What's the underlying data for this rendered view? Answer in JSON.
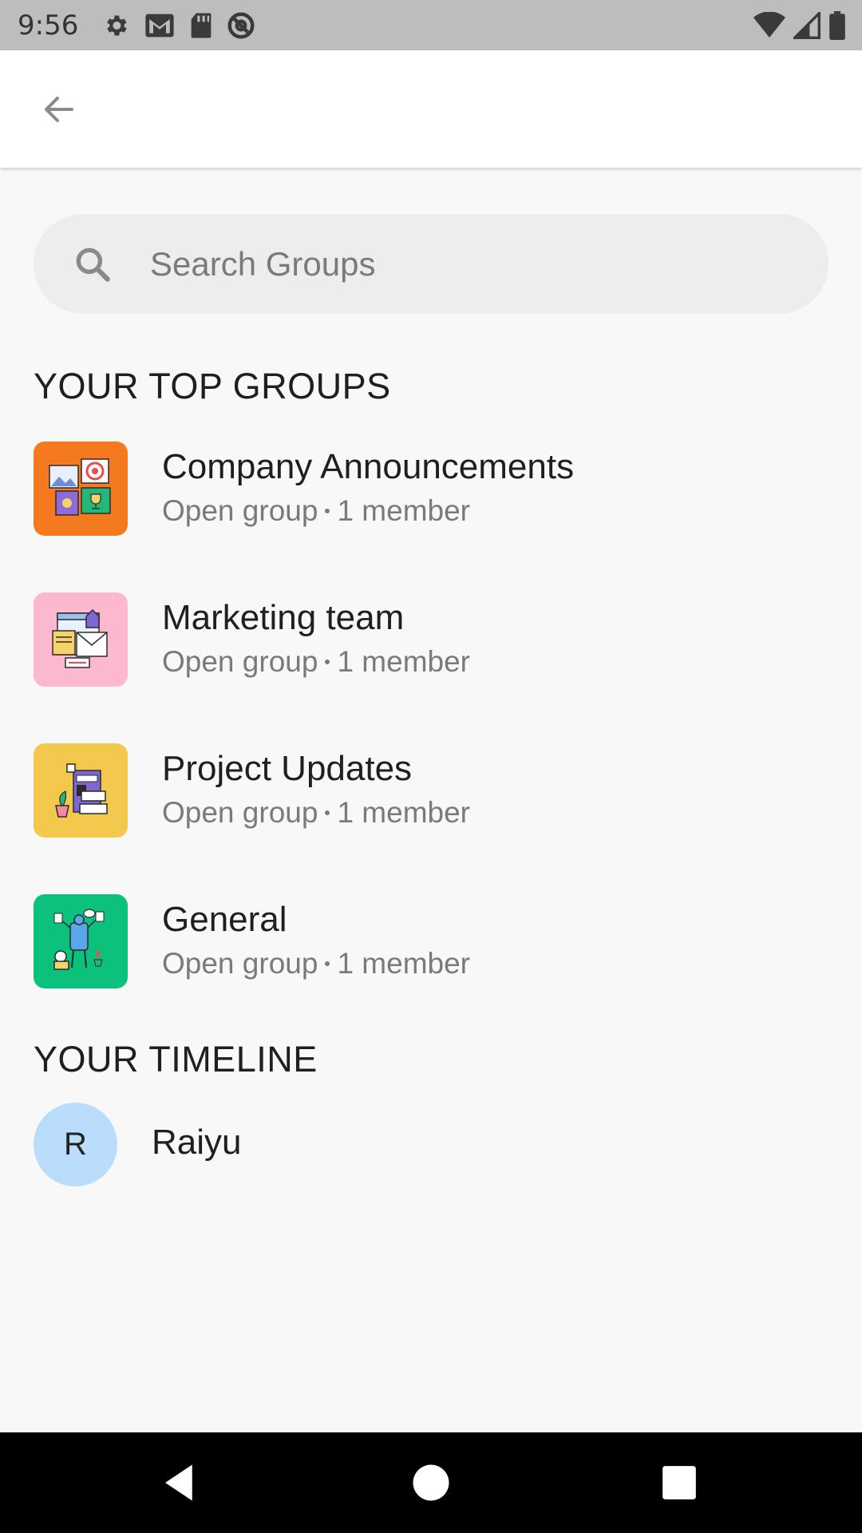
{
  "status_bar": {
    "time": "9:56",
    "left_icons": [
      "gear-icon",
      "gmail-icon",
      "sd-card-icon",
      "at-sign-icon"
    ],
    "right_icons": [
      "wifi-icon",
      "signal-icon",
      "battery-icon"
    ]
  },
  "app_bar": {
    "back_icon": "arrow-back-icon"
  },
  "search": {
    "placeholder": "Search Groups",
    "value": ""
  },
  "top_groups": {
    "header": "YOUR TOP GROUPS",
    "items": [
      {
        "name": "Company Announcements",
        "type": "Open group",
        "members": "1 member",
        "color": "#f5791f",
        "icon": "announcements-illustration"
      },
      {
        "name": "Marketing team",
        "type": "Open group",
        "members": "1 member",
        "color": "#fcb8cf",
        "icon": "marketing-illustration"
      },
      {
        "name": "Project Updates",
        "type": "Open group",
        "members": "1 member",
        "color": "#f2c94c",
        "icon": "project-illustration"
      },
      {
        "name": "General",
        "type": "Open group",
        "members": "1 member",
        "color": "#0bc27c",
        "icon": "general-illustration"
      }
    ]
  },
  "timeline": {
    "header": "YOUR TIMELINE",
    "user": {
      "initial": "R",
      "name": "Raiyu",
      "avatar_color": "#b9ddfb"
    }
  },
  "nav_bar": {
    "buttons": [
      "back-triangle-icon",
      "home-circle-icon",
      "recents-square-icon"
    ]
  }
}
